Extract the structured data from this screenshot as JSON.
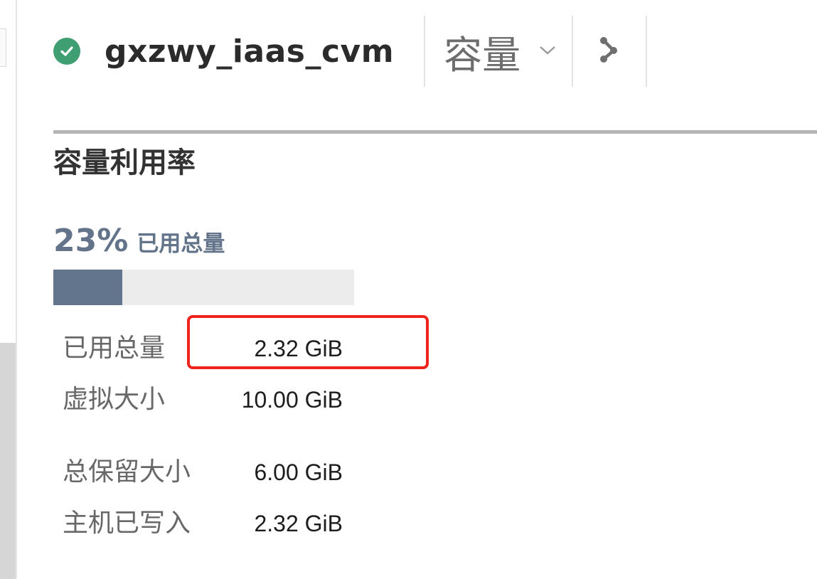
{
  "header": {
    "title": "gxzwy_iaas_cvm",
    "status_color": "#3f9e72",
    "status_icon": "check-circle-icon",
    "view_selector": {
      "label": "容量",
      "icon": "chevron-down-icon"
    },
    "share_icon": "share-icon"
  },
  "capacity": {
    "section_title": "容量利用率",
    "used_percent_text": "23%",
    "used_percent_label": "已用总量",
    "used_fraction": 0.23,
    "bar_color": "#62758c",
    "stats": [
      {
        "label": "已用总量",
        "value": "2.32 GiB"
      },
      {
        "label": "虚拟大小",
        "value": "10.00 GiB"
      },
      {
        "label": "总保留大小",
        "value": "6.00 GiB"
      },
      {
        "label": "主机已写入",
        "value": "2.32 GiB"
      }
    ]
  },
  "highlight_color": "#f0221c"
}
